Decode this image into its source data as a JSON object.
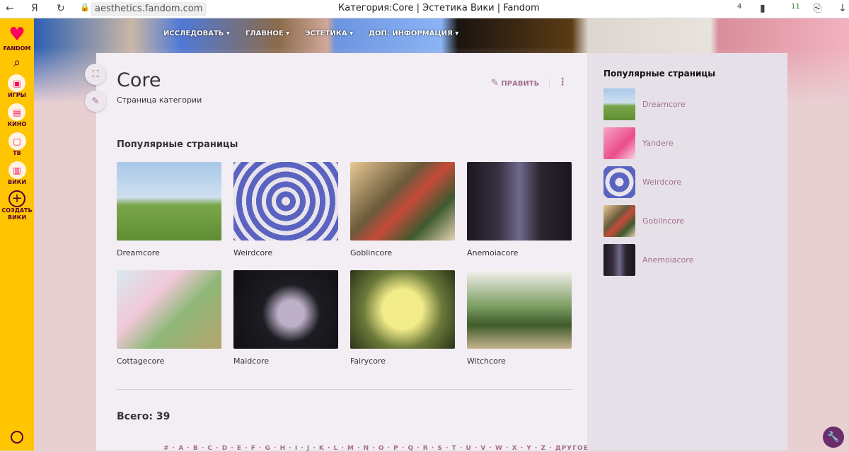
{
  "browser": {
    "url": "aesthetics.fandom.com",
    "title": "Категория:Core | Эстетика Вики | Fandom",
    "badges": [
      "4",
      "11"
    ]
  },
  "fandom_nav": {
    "logo": "FANDOM",
    "items": [
      {
        "label": "ИГРЫ",
        "icon": "gamepad-icon"
      },
      {
        "label": "КИНО",
        "icon": "clapper-icon"
      },
      {
        "label": "ТВ",
        "icon": "tv-icon"
      },
      {
        "label": "ВИКИ",
        "icon": "book-icon"
      },
      {
        "label": "СОЗДАТЬ ВИКИ",
        "icon": "plus-icon"
      }
    ]
  },
  "wiki_nav": [
    "ИССЛЕДОВАТЬ",
    "ГЛАВНОЕ",
    "ЭСТЕТИКА",
    "ДОП. ИНФОРМАЦИЯ"
  ],
  "page": {
    "title": "Core",
    "subtitle": "Страница категории",
    "edit_label": "ПРАВИТЬ",
    "popular_heading": "Популярные страницы",
    "total": "Всего: 39",
    "letters": "# · A · B · C · D · E · F · G · H · I · J · K · L · M · N · O · P · Q · R · S · T · U · V · W · X · Y · Z · ДРУГОЕ"
  },
  "tiles": [
    {
      "label": "Dreamcore"
    },
    {
      "label": "Weirdcore"
    },
    {
      "label": "Goblincore"
    },
    {
      "label": "Anemoiacore"
    },
    {
      "label": "Cottagecore"
    },
    {
      "label": "Maidcore"
    },
    {
      "label": "Fairycore"
    },
    {
      "label": "Witchcore"
    }
  ],
  "rail": {
    "heading": "Популярные страницы",
    "items": [
      {
        "label": "Dreamcore"
      },
      {
        "label": "Yandere"
      },
      {
        "label": "Weirdcore"
      },
      {
        "label": "Goblincore"
      },
      {
        "label": "Anemoiacore"
      }
    ]
  },
  "colors": {
    "fandom_yellow": "#ffc500",
    "link": "#a2708f",
    "accent": "#6b2e6b"
  }
}
